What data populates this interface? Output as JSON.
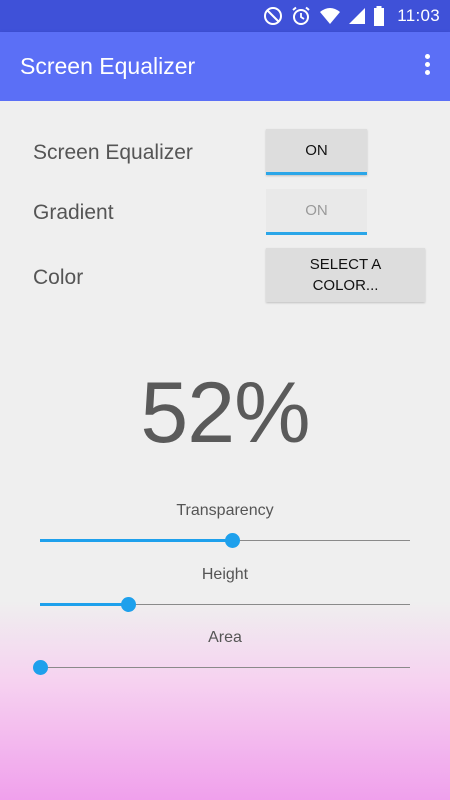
{
  "status_bar": {
    "time": "11:03",
    "icons": [
      "do-not-disturb-icon",
      "alarm-icon",
      "wifi-icon",
      "signal-icon",
      "battery-icon"
    ]
  },
  "app_bar": {
    "title": "Screen Equalizer",
    "menu_icon": "more-vert-icon"
  },
  "settings": {
    "screen_equalizer": {
      "label": "Screen Equalizer",
      "toggle": "ON"
    },
    "gradient": {
      "label": "Gradient",
      "toggle": "ON"
    },
    "color": {
      "label": "Color",
      "button": "SELECT A COLOR..."
    }
  },
  "percent": "52%",
  "sliders": [
    {
      "label": "Transparency",
      "value": 0.52
    },
    {
      "label": "Height",
      "value": 0.24
    },
    {
      "label": "Area",
      "value": 0.0
    }
  ],
  "colors": {
    "status_bar": "#3f51d8",
    "app_bar": "#5b6ff6",
    "accent": "#1ea0ec",
    "gradient_bottom": "#f0a0ec"
  }
}
